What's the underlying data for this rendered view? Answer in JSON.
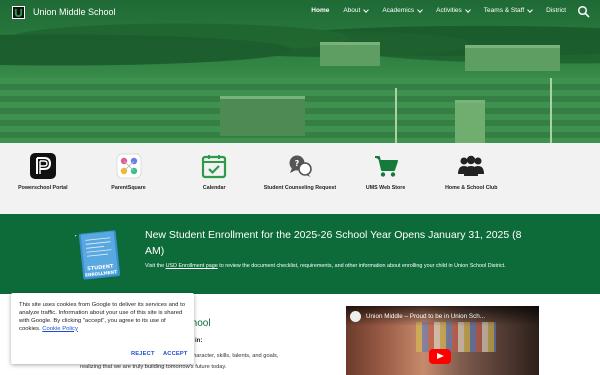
{
  "site": {
    "title": "Union Middle School"
  },
  "nav": {
    "items": [
      {
        "label": "Home",
        "dropdown": false,
        "active": true
      },
      {
        "label": "About",
        "dropdown": true
      },
      {
        "label": "Academics",
        "dropdown": true
      },
      {
        "label": "Activities",
        "dropdown": true
      },
      {
        "label": "Teams & Staff",
        "dropdown": true
      },
      {
        "label": "District",
        "dropdown": false
      }
    ],
    "search_icon": "search-icon"
  },
  "quick_links": [
    {
      "label": "Powerschool Portal",
      "icon": "powerschool-icon"
    },
    {
      "label": "ParentSquare",
      "icon": "parentsquare-icon"
    },
    {
      "label": "Calendar",
      "icon": "calendar-icon"
    },
    {
      "label": "Student Counseling Request",
      "icon": "counseling-icon"
    },
    {
      "label": "UMS Web Store",
      "icon": "cart-icon"
    },
    {
      "label": "Home & School Club",
      "icon": "people-icon"
    }
  ],
  "banner": {
    "heading": "New Student Enrollment for the 2025-26 School Year Opens January 31, 2025 (8 AM)",
    "text_before": "Visit the ",
    "link": "USD Enrollment page",
    "text_after": " to review the document checklist, requirements, and other information about enrolling your child in Union School District.",
    "card_text_1": "STUDENT",
    "card_text_2": "ENROLLMENT"
  },
  "main": {
    "title": "School",
    "subtitle": "lieve in:",
    "line1": "nts' character, skills, talents, and goals,",
    "line2": "realizing that we are truly building tomorrow's future today."
  },
  "video": {
    "title": "Union Middle – Proud to be in Union Sch..."
  },
  "cookie": {
    "text": "This site uses cookies from Google to deliver its services and to analyze traffic. Information about your use of this site is shared with Google. By clicking \"accept\", you agree to its use of cookies. ",
    "link": "Cookie Policy",
    "reject": "REJECT",
    "accept": "ACCEPT"
  },
  "colors": {
    "brand_green": "#0d6b3a",
    "link_blue": "#1a4fd3"
  }
}
